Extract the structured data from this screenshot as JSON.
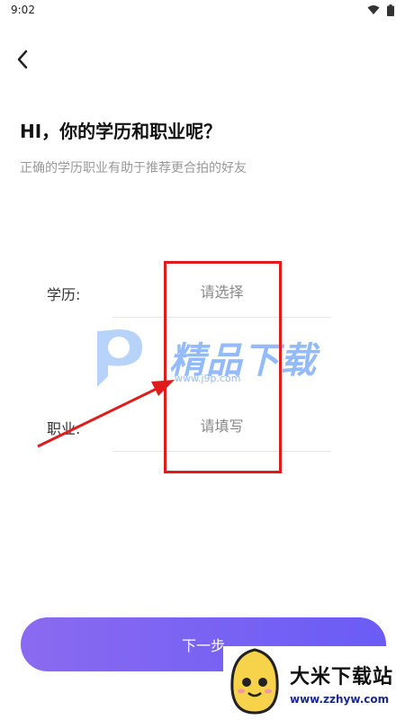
{
  "status_bar": {
    "time": "9:02"
  },
  "header": {
    "title": "HI，你的学历和职业呢？",
    "subtitle": "正确的学历职业有助于推荐更合拍的好友"
  },
  "form": {
    "education": {
      "label": "学历:",
      "placeholder": "请选择"
    },
    "occupation": {
      "label": "职业:",
      "placeholder": "请填写"
    }
  },
  "next_button": {
    "label": "下一步"
  },
  "watermark": {
    "text": "精品下载",
    "url": "www.j9p.com"
  },
  "promo": {
    "name": "大米下载站",
    "url": "www.zzhyw.com"
  },
  "colors": {
    "accent": "#6a5cf5",
    "highlight": "#e01b1b"
  }
}
